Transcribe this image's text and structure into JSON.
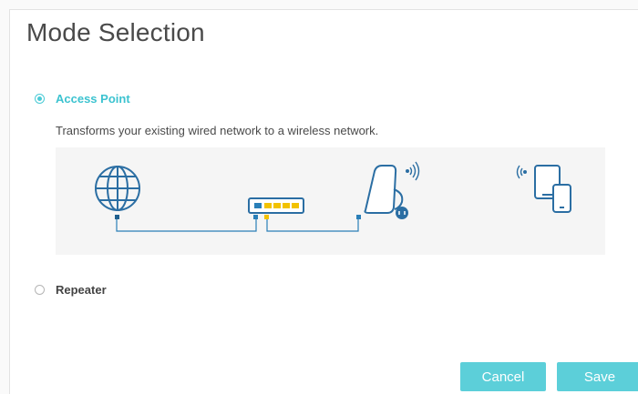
{
  "page": {
    "title": "Mode Selection"
  },
  "options": {
    "access_point": {
      "label": "Access Point",
      "description": "Transforms your existing wired network to a wireless network.",
      "selected": true
    },
    "repeater": {
      "label": "Repeater",
      "selected": false
    }
  },
  "diagram": {
    "icons": [
      "globe-icon",
      "switch-icon",
      "extender-icon",
      "wifi-signal-icon",
      "devices-icon"
    ]
  },
  "buttons": {
    "cancel": "Cancel",
    "save": "Save"
  },
  "colors": {
    "accent": "#4acbd6",
    "button": "#5ccfd9",
    "cable": "#2a7fb8",
    "port_yellow": "#f2c200"
  }
}
